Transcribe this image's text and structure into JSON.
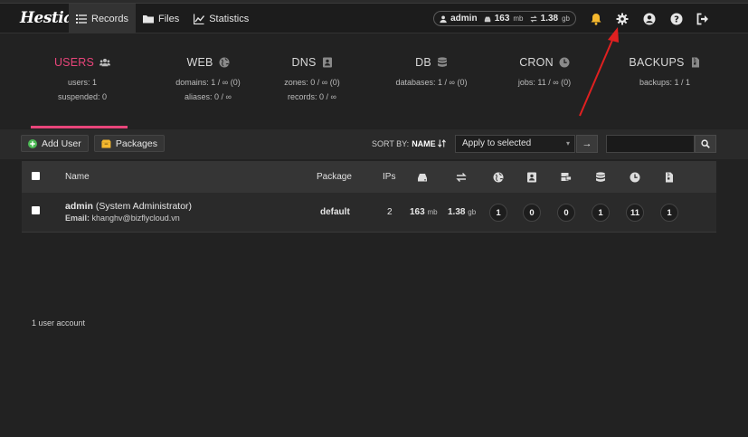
{
  "brand": {
    "logo_text": "Hestia"
  },
  "nav": [
    {
      "label": "Records",
      "icon": "list-icon",
      "active": true
    },
    {
      "label": "Files",
      "icon": "folder-icon",
      "active": false
    },
    {
      "label": "Statistics",
      "icon": "chart-icon",
      "active": false
    }
  ],
  "account": {
    "user": "admin",
    "disk_value": "163",
    "disk_unit": "mb",
    "bw_value": "1.38",
    "bw_unit": "gb"
  },
  "accent_color": "#e8457a",
  "stats": {
    "users": {
      "title": "USERS",
      "line1": "users: 1",
      "line2": "suspended: 0"
    },
    "web": {
      "title": "WEB",
      "line1": "domains: 1 / ∞ (0)",
      "line2": "aliases: 0 / ∞"
    },
    "dns": {
      "title": "DNS",
      "line1": "zones: 0 / ∞ (0)",
      "line2": "records: 0 / ∞"
    },
    "db": {
      "title": "DB",
      "line1": "databases: 1 / ∞ (0)",
      "line2": ""
    },
    "cron": {
      "title": "CRON",
      "line1": "jobs: 11 / ∞ (0)",
      "line2": ""
    },
    "backups": {
      "title": "BACKUPS",
      "line1": "backups: 1 / 1",
      "line2": ""
    }
  },
  "toolbar": {
    "add_user": "Add User",
    "packages": "Packages",
    "sort_label": "SORT BY:",
    "sort_value": "NAME",
    "bulk_action": "Apply to selected",
    "search_placeholder": ""
  },
  "table": {
    "headers": {
      "name": "Name",
      "package": "Package",
      "ips": "IPs"
    },
    "rows": [
      {
        "username": "admin",
        "fullname": "(System Administrator)",
        "email_label": "Email:",
        "email": "khanghv@bizflycloud.vn",
        "package": "default",
        "ips": "2",
        "disk_value": "163",
        "disk_unit": "mb",
        "bw_value": "1.38",
        "bw_unit": "gb",
        "web": "1",
        "dns": "0",
        "mail": "0",
        "db": "1",
        "cron": "11",
        "backups": "1"
      }
    ]
  },
  "footer": {
    "count_text": "1 user account"
  }
}
